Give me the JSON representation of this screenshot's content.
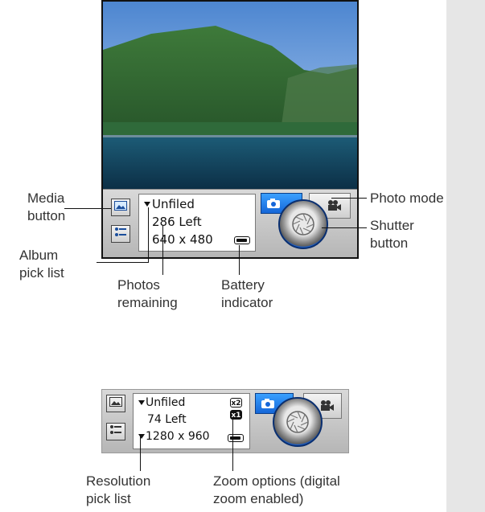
{
  "screen": {
    "album": "Unfiled",
    "remaining": "286 Left",
    "resolution": "640 x 480"
  },
  "toolbar2": {
    "album": "Unfiled",
    "remaining": "74 Left",
    "resolution": "1280 x 960",
    "zoom_x2": "x2",
    "zoom_x1": "x1"
  },
  "callouts": {
    "media_button": [
      "Media",
      "button"
    ],
    "album_pick_list": [
      "Album",
      "pick list"
    ],
    "photos_remaining": [
      "Photos",
      "remaining"
    ],
    "battery_indicator": [
      "Battery",
      "indicator"
    ],
    "photo_mode": "Photo mode",
    "shutter_button": [
      "Shutter",
      "button"
    ],
    "resolution_pick_list": [
      "Resolution",
      "pick list"
    ],
    "zoom_options": [
      "Zoom options (digital",
      "zoom enabled)"
    ]
  },
  "icons": {
    "media": "picture-icon",
    "album": "list-icon",
    "photo_mode": "camera-icon",
    "video_mode": "video-camera-icon",
    "shutter": "aperture-icon",
    "battery": "battery-icon"
  },
  "colors": {
    "accent_blue": "#1566d8",
    "sidebar": "#e6e6e6"
  }
}
